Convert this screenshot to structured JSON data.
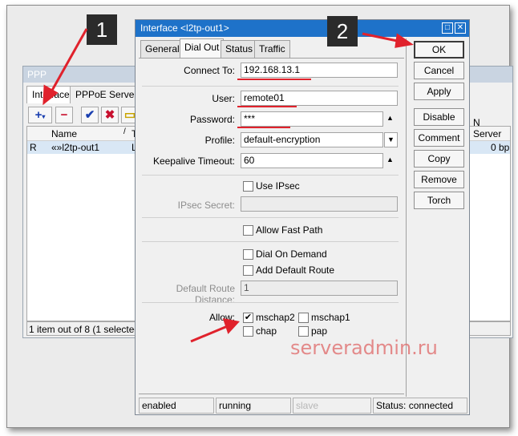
{
  "ppp": {
    "title": "PPP",
    "tabs": [
      "Interface",
      "PPPoE Servers"
    ],
    "toolbar": [
      "+",
      "−",
      "✔",
      "✖",
      "▭"
    ],
    "columns": [
      "Name",
      "T"
    ],
    "rows": [
      {
        "flag": "R",
        "name": "«»l2tp-out1",
        "type": "L"
      }
    ],
    "right_header": "N Server",
    "right_value": "0 bp",
    "status": "1 item out of 8 (1 selected)"
  },
  "dialog": {
    "title": "Interface <l2tp-out1>",
    "tabs": [
      "General",
      "Dial Out",
      "Status",
      "Traffic"
    ],
    "active_tab": "Dial Out",
    "fields": {
      "connect_to_label": "Connect To:",
      "connect_to": "192.168.13.1",
      "user_label": "User:",
      "user": "remote01",
      "password_label": "Password:",
      "password": "***",
      "profile_label": "Profile:",
      "profile": "default-encryption",
      "keepalive_label": "Keepalive Timeout:",
      "keepalive": "60",
      "use_ipsec": "Use IPsec",
      "ipsec_secret_label": "IPsec Secret:",
      "ipsec_secret": "",
      "fast_path": "Allow Fast Path",
      "dial_on_demand": "Dial On Demand",
      "default_route": "Add Default Route",
      "default_route_distance_label": "Default Route Distance:",
      "default_route_distance": "1",
      "allow_label": "Allow:",
      "allow": [
        {
          "label": "mschap2",
          "checked": true
        },
        {
          "label": "mschap1",
          "checked": false
        },
        {
          "label": "chap",
          "checked": false
        },
        {
          "label": "pap",
          "checked": false
        }
      ]
    },
    "buttons": [
      "OK",
      "Cancel",
      "Apply",
      "Disable",
      "Comment",
      "Copy",
      "Remove",
      "Torch"
    ],
    "statusbar": [
      "enabled",
      "running",
      "slave",
      "Status: connected"
    ]
  },
  "annotations": {
    "badge1": "1",
    "badge2": "2",
    "watermark": "serveradmin.ru",
    "accent": "#e0222c"
  }
}
